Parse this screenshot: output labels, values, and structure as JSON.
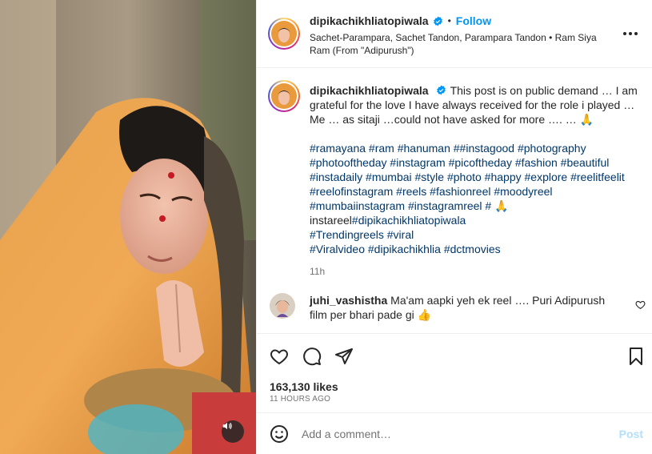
{
  "post": {
    "username": "dipikachikhliatopiwala",
    "follow_label": "Follow",
    "separator": "•",
    "audio": "Sachet-Parampara, Sachet Tandon, Parampara Tandon • Ram Siya Ram (From \"Adipurush\")"
  },
  "caption": {
    "username": "dipikachikhliatopiwala",
    "text": "This post is on public demand … I am grateful for the love I have always received for the role i played … Me … as sitaji …could not have asked for more …. …  🙏",
    "tag_lines": [
      "#ramayana #ram #hanuman ##instagood #photography",
      "#photooftheday #instagram #picoftheday #fashion #beautiful",
      "#instadaily #mumbai #style #photo #happy #explore #reelitfeelit",
      "#reelofinstagram #reels #fashionreel #moodyreel",
      "#mumbaiinstagram #instagramreel # 🙏"
    ],
    "plain_prefix": "instareel",
    "tag_after_prefix": "#dipikachikhliatopiwala",
    "tag_lines_2": [
      "#Trendingreels #viral",
      "#Viralvideo #dipikachikhlia #dctmovies"
    ],
    "time": "11h"
  },
  "comment": {
    "username": "juhi_vashistha",
    "text": "Ma'am aapki yeh ek reel …. Puri Adipurush film per bhari pade gi 👍"
  },
  "stats": {
    "likes": "163,130 likes",
    "posted": "11 HOURS AGO"
  },
  "composer": {
    "placeholder": "Add a comment…",
    "post_label": "Post"
  },
  "icons": {
    "verified": "verified-badge-icon",
    "more": "more-options-icon",
    "like": "heart-icon",
    "comment": "comment-bubble-icon",
    "share": "paper-plane-icon",
    "save": "bookmark-icon",
    "emoji": "emoji-icon",
    "sound": "speaker-icon"
  },
  "colors": {
    "link": "#00376b",
    "follow": "#0095f6",
    "verified": "#0095f6",
    "muted": "#737373",
    "post_disabled": "#b2dffc"
  }
}
